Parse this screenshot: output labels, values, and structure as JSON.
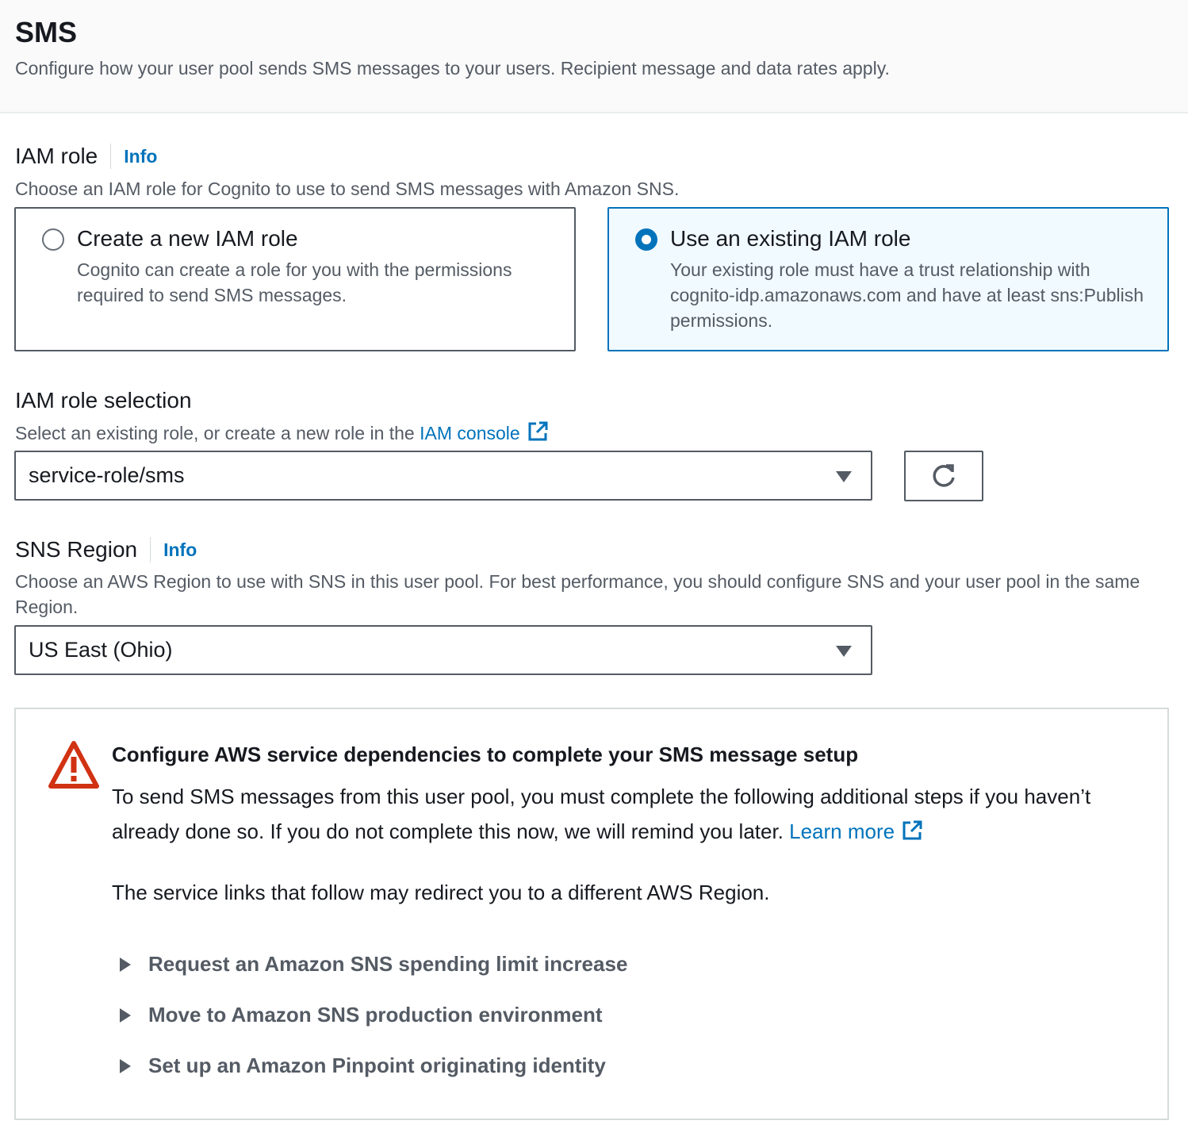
{
  "header": {
    "title": "SMS",
    "description": "Configure how your user pool sends SMS messages to your users. Recipient message and data rates apply."
  },
  "iam_role": {
    "label": "IAM role",
    "info": "Info",
    "description": "Choose an IAM role for Cognito to use to send SMS messages with Amazon SNS.",
    "options": [
      {
        "title": "Create a new IAM role",
        "description": "Cognito can create a role for you with the permissions required to send SMS messages.",
        "selected": false
      },
      {
        "title": "Use an existing IAM role",
        "description": "Your existing role must have a trust relationship with cognito-idp.amazonaws.com and have at least sns:Publish permissions.",
        "selected": true
      }
    ]
  },
  "iam_role_selection": {
    "label": "IAM role selection",
    "description_prefix": "Select an existing role, or create a new role in the ",
    "link_text": "IAM console",
    "value": "service-role/sms"
  },
  "sns_region": {
    "label": "SNS Region",
    "info": "Info",
    "description": "Choose an AWS Region to use with SNS in this user pool. For best performance, you should configure SNS and your user pool in the same Region.",
    "value": "US East (Ohio)"
  },
  "alert": {
    "title": "Configure AWS service dependencies to complete your SMS message setup",
    "body": "To send SMS messages from this user pool, you must complete the following additional steps if you haven’t already done so. If you do not complete this now, we will remind you later.",
    "learn_more": "Learn more",
    "note": "The service links that follow may redirect you to a different AWS Region.",
    "steps": [
      "Request an Amazon SNS spending limit increase",
      "Move to Amazon SNS production environment",
      "Set up an Amazon Pinpoint originating identity"
    ]
  },
  "colors": {
    "link": "#0073bb",
    "selected_bg": "#f1faff",
    "warning": "#d13212"
  }
}
